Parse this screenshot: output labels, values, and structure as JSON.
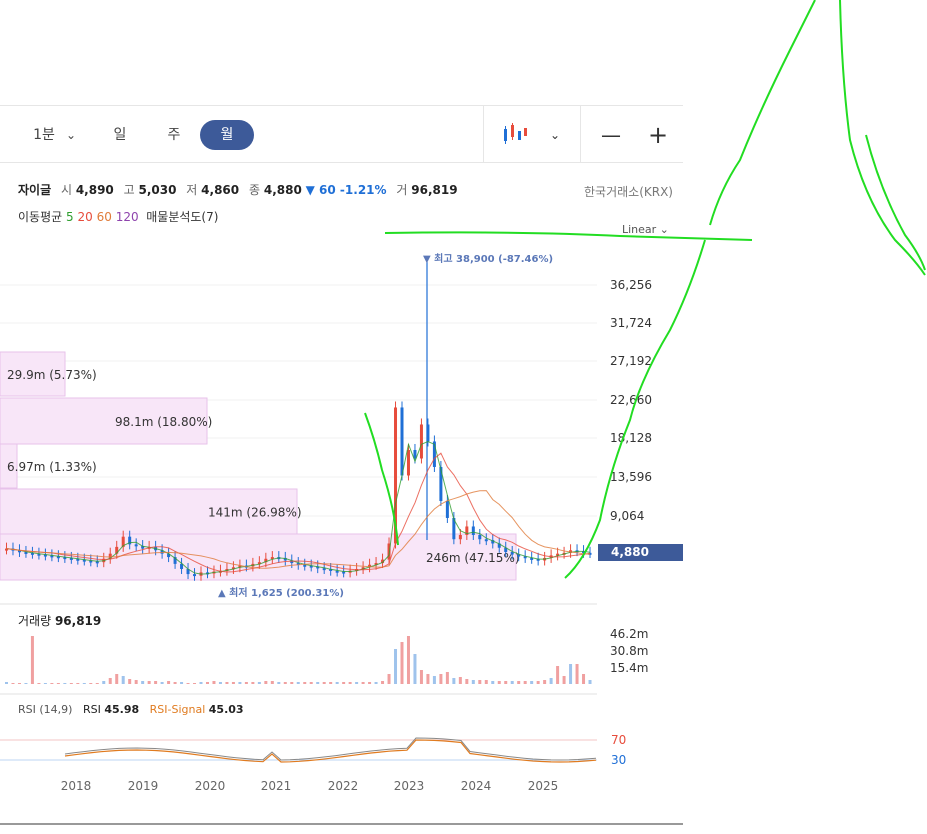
{
  "toolbar": {
    "intervals": [
      {
        "label": "1분",
        "active": false
      },
      {
        "label": "일",
        "active": false
      },
      {
        "label": "주",
        "active": false
      },
      {
        "label": "월",
        "active": true
      }
    ],
    "chart_type_icon": "candlestick-icon",
    "zoom_out": "—",
    "zoom_in": "+"
  },
  "stock": {
    "name": "자이글",
    "open_label": "시",
    "open": "4,890",
    "high_label": "고",
    "high": "5,030",
    "low_label": "저",
    "low": "4,860",
    "close_label": "종",
    "close": "4,880",
    "change": "▼ 60 -1.21%",
    "volume_label": "거",
    "volume": "96,819",
    "exchange": "한국거래소(KRX)"
  },
  "indicators": {
    "ma_label": "이동평균",
    "ma_periods": [
      "5",
      "20",
      "60",
      "120"
    ],
    "ma_colors": [
      "#2e9e2e",
      "#e74c3c",
      "#e07b39",
      "#8e44ad"
    ],
    "vp_label": "매물분석도(7)"
  },
  "scale_mode": "Linear",
  "chart_data": [
    {
      "type": "candlestick",
      "y_ticks": [
        "36,256",
        "31,724",
        "27,192",
        "22,660",
        "18,128",
        "13,596",
        "9,064"
      ],
      "current_price": "4,880",
      "high_marker": "▼ 최고 38,900 (-87.46%)",
      "low_marker": "▲ 최저 1,625 (200.31%)",
      "volume_profile": [
        "29.9m (5.73%)",
        "98.1m (18.80%)",
        "6.97m (1.33%)",
        "141m (26.98%)",
        "246m (47.15%)"
      ],
      "up_color": "#e74c3c",
      "down_color": "#1f6fd6"
    },
    {
      "type": "bar",
      "title": "거래량",
      "last_value": "96,819",
      "y_ticks": [
        "46.2m",
        "30.8m",
        "15.4m"
      ]
    },
    {
      "type": "line",
      "title": "RSI (14,9)",
      "series": [
        {
          "name": "RSI",
          "last": "45.98",
          "color": "#888888"
        },
        {
          "name": "RSI-Signal",
          "last": "45.03",
          "color": "#e07b20"
        }
      ],
      "levels": [
        "70",
        "30"
      ],
      "x_ticks": [
        "2018",
        "2019",
        "2020",
        "2021",
        "2022",
        "2023",
        "2024",
        "2025"
      ]
    }
  ]
}
